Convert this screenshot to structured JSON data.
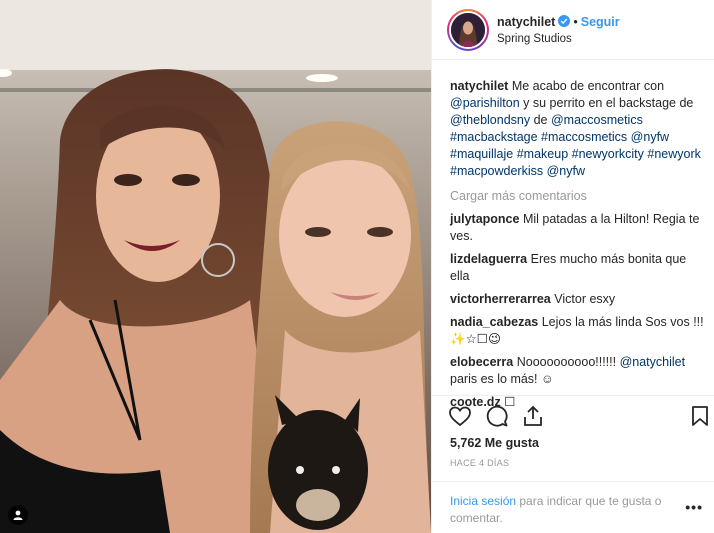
{
  "header": {
    "username": "natychilet",
    "separator": "•",
    "follow_label": "Seguir",
    "location": "Spring Studios"
  },
  "caption": {
    "username": "natychilet",
    "parts": [
      {
        "text": "Me acabo de encontrar con ",
        "type": "text"
      },
      {
        "text": "@parishilton",
        "type": "tag"
      },
      {
        "text": " y su perrito en el backstage de ",
        "type": "text"
      },
      {
        "text": "@theblondsny",
        "type": "tag"
      },
      {
        "text": " de ",
        "type": "text"
      },
      {
        "text": "@maccosmetics",
        "type": "tag"
      },
      {
        "text": " ",
        "type": "text"
      },
      {
        "text": "#macbackstage",
        "type": "tag"
      },
      {
        "text": " ",
        "type": "text"
      },
      {
        "text": "#maccosmetics",
        "type": "tag"
      },
      {
        "text": " ",
        "type": "text"
      },
      {
        "text": "@nyfw",
        "type": "tag"
      },
      {
        "text": " ",
        "type": "text"
      },
      {
        "text": "#maquillaje",
        "type": "tag"
      },
      {
        "text": " ",
        "type": "text"
      },
      {
        "text": "#makeup",
        "type": "tag"
      },
      {
        "text": " ",
        "type": "text"
      },
      {
        "text": "#newyorkcity",
        "type": "tag"
      },
      {
        "text": " ",
        "type": "text"
      },
      {
        "text": "#newyork",
        "type": "tag"
      },
      {
        "text": " ",
        "type": "text"
      },
      {
        "text": "#macpowderkiss",
        "type": "tag"
      },
      {
        "text": " ",
        "type": "text"
      },
      {
        "text": "@nyfw",
        "type": "tag"
      }
    ]
  },
  "load_more_label": "Cargar más comentarios",
  "comments": [
    {
      "username": "julytaponce",
      "parts": [
        {
          "text": "Mil patadas a la Hilton! Regia te ves.",
          "type": "text"
        }
      ]
    },
    {
      "username": "lizdelaguerra",
      "parts": [
        {
          "text": "Eres mucho más bonita que ella",
          "type": "text"
        }
      ]
    },
    {
      "username": "victorherrerarrea",
      "parts": [
        {
          "text": "Victor esxy",
          "type": "text"
        }
      ]
    },
    {
      "username": "nadia_cabezas",
      "parts": [
        {
          "text": "Lejos la más linda Sos vos !!! ✨☆☐😉",
          "type": "text"
        }
      ]
    },
    {
      "username": "elobecerra",
      "parts": [
        {
          "text": "Noooooooooo!!!!!! ",
          "type": "text"
        },
        {
          "text": "@natychilet",
          "type": "tag"
        },
        {
          "text": " paris es lo más! ☺",
          "type": "text"
        }
      ]
    },
    {
      "username": "coote.dz",
      "parts": [
        {
          "text": "☐",
          "type": "text"
        }
      ]
    }
  ],
  "actions": {
    "like_icon": "heart-icon",
    "comment_icon": "comment-icon",
    "share_icon": "share-icon",
    "save_icon": "bookmark-icon"
  },
  "likes_label": "5,762 Me gusta",
  "timestamp": "HACE 4 DÍAS",
  "login": {
    "link_label": "Inicia sesión",
    "rest": " para indicar que te gusta o comentar.",
    "more_label": "•••"
  },
  "colors": {
    "link": "#3897f0",
    "tag": "#003569",
    "muted": "#999999",
    "border": "#efefef"
  }
}
